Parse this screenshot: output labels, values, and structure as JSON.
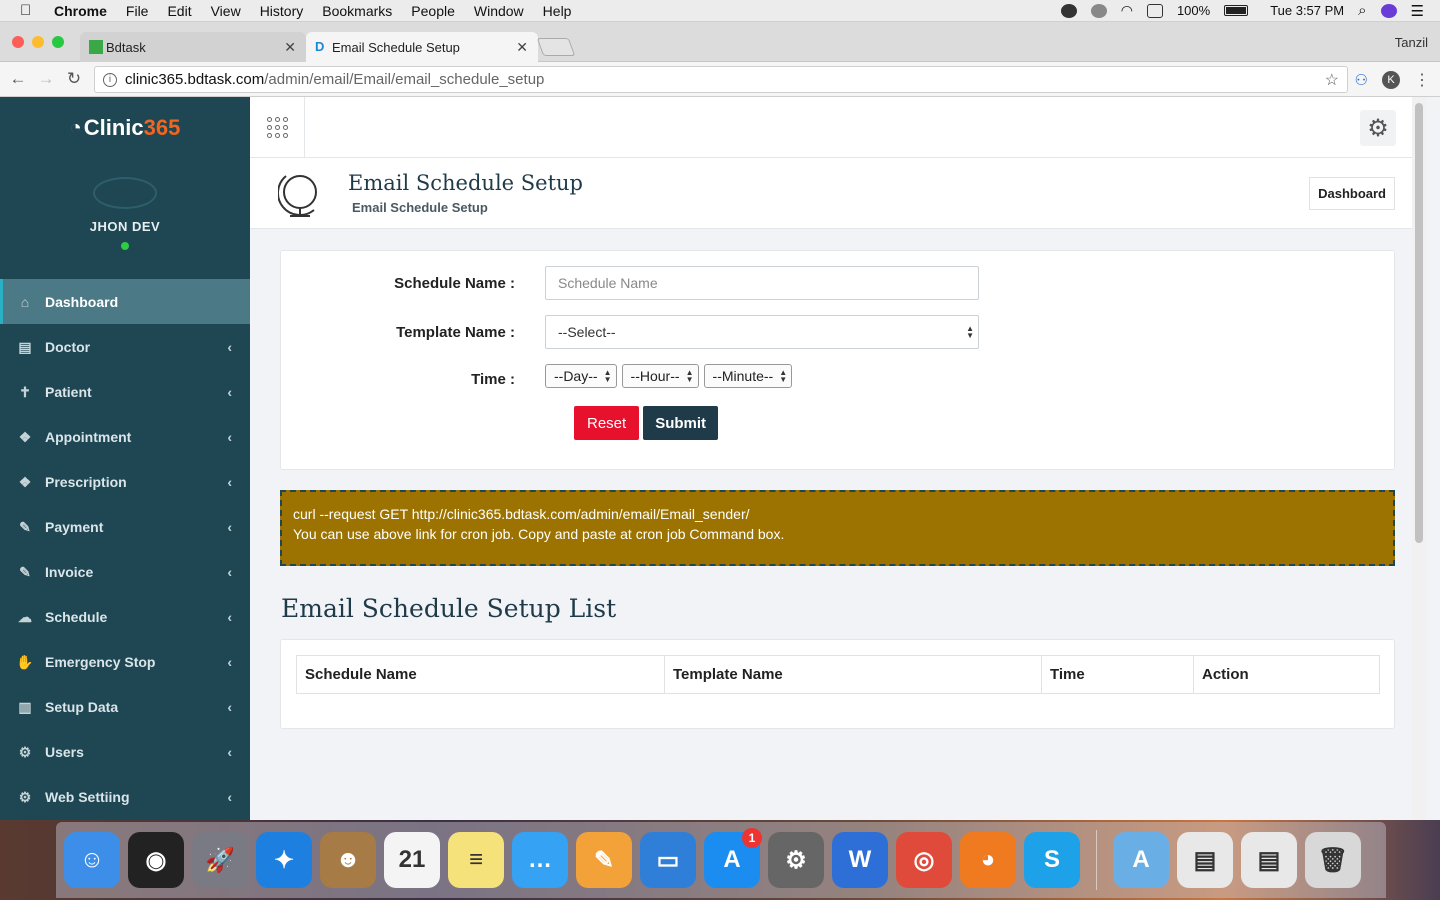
{
  "menubar": {
    "app": "Chrome",
    "items": [
      "File",
      "Edit",
      "View",
      "History",
      "Bookmarks",
      "People",
      "Window",
      "Help"
    ],
    "battery": "100%",
    "clock": "Tue 3:57 PM"
  },
  "browser": {
    "tabs": [
      {
        "title": "Bdtask",
        "favicon_color": "#3aa845"
      },
      {
        "title": "Email Schedule Setup",
        "favicon_color": "#1a8ad6"
      }
    ],
    "profile": "Tanzil",
    "url_host": "clinic365.bdtask.com",
    "url_path": "/admin/email/Email/email_schedule_setup",
    "avatar_letter": "K"
  },
  "sidebar": {
    "brand_main": "Clinic",
    "brand_accent": "365",
    "user_name": "JHON DEV",
    "items": [
      {
        "label": "Dashboard",
        "icon": "home-icon",
        "glyph": "⌂",
        "active": true
      },
      {
        "label": "Doctor",
        "icon": "document-icon",
        "glyph": "▤"
      },
      {
        "label": "Patient",
        "icon": "person-icon",
        "glyph": "✝"
      },
      {
        "label": "Appointment",
        "icon": "cube-icon",
        "glyph": "❖"
      },
      {
        "label": "Prescription",
        "icon": "cube-icon",
        "glyph": "❖"
      },
      {
        "label": "Payment",
        "icon": "tag-icon",
        "glyph": "✎"
      },
      {
        "label": "Invoice",
        "icon": "tag-icon",
        "glyph": "✎"
      },
      {
        "label": "Schedule",
        "icon": "chat-icon",
        "glyph": "☁"
      },
      {
        "label": "Emergency Stop",
        "icon": "hand-icon",
        "glyph": "✋"
      },
      {
        "label": "Setup Data",
        "icon": "bar-chart-icon",
        "glyph": "▥"
      },
      {
        "label": "Users",
        "icon": "gears-icon",
        "glyph": "⚙"
      },
      {
        "label": "Web Settiing",
        "icon": "gears-icon",
        "glyph": "⚙"
      }
    ]
  },
  "header": {
    "title": "Email Schedule Setup",
    "subtitle": "Email Schedule Setup",
    "breadcrumb_button": "Dashboard"
  },
  "form": {
    "schedule_label": "Schedule Name :",
    "schedule_placeholder": "Schedule Name",
    "template_label": "Template Name :",
    "template_value": "--Select--",
    "time_label": "Time :",
    "day_value": "--Day--",
    "hour_value": "--Hour--",
    "minute_value": "--Minute--",
    "reset_label": "Reset",
    "submit_label": "Submit"
  },
  "cron": {
    "line1": "curl --request GET http://clinic365.bdtask.com/admin/email/Email_sender/",
    "line2": "You can use above link for cron job. Copy and paste at cron job Command box."
  },
  "list": {
    "title": "Email Schedule Setup List",
    "columns": [
      "Schedule Name",
      "Template Name",
      "Time",
      "Action"
    ]
  },
  "dock": {
    "apps": [
      {
        "name": "finder-icon",
        "color": "#3d8ee8",
        "glyph": "☺"
      },
      {
        "name": "siri-icon",
        "color": "#222",
        "glyph": "◉"
      },
      {
        "name": "launchpad-icon",
        "color": "#7a7a85",
        "glyph": "🚀"
      },
      {
        "name": "safari-icon",
        "color": "#1d7fe0",
        "glyph": "✦"
      },
      {
        "name": "contacts-icon",
        "color": "#a77b45",
        "glyph": "☻"
      },
      {
        "name": "calendar-icon",
        "color": "#f4f4f4",
        "glyph": "21"
      },
      {
        "name": "notes-icon",
        "color": "#f6e27a",
        "glyph": "≡"
      },
      {
        "name": "messages-icon",
        "color": "#35a2f4",
        "glyph": "…"
      },
      {
        "name": "pages-icon",
        "color": "#f3a23a",
        "glyph": "✎"
      },
      {
        "name": "keynote-icon",
        "color": "#2f7fd8",
        "glyph": "▭"
      },
      {
        "name": "app-store-icon",
        "color": "#1b8cf0",
        "glyph": "A",
        "badge": "1"
      },
      {
        "name": "system-preferences-icon",
        "color": "#666",
        "glyph": "⚙"
      },
      {
        "name": "word-icon",
        "color": "#2d6fd6",
        "glyph": "W"
      },
      {
        "name": "chrome-icon",
        "color": "#e04a3a",
        "glyph": "◎"
      },
      {
        "name": "firefox-icon",
        "color": "#ef7a1f",
        "glyph": "◕"
      },
      {
        "name": "skype-icon",
        "color": "#1da1e8",
        "glyph": "S"
      }
    ],
    "right": [
      {
        "name": "applications-folder-icon",
        "color": "#6aaee6",
        "glyph": "A"
      },
      {
        "name": "documents-stack-icon",
        "color": "#e8e8e8",
        "glyph": "▤"
      },
      {
        "name": "downloads-stack-icon",
        "color": "#e8e8e8",
        "glyph": "▤"
      },
      {
        "name": "trash-icon",
        "color": "#d8d8d8",
        "glyph": "🗑"
      }
    ]
  }
}
